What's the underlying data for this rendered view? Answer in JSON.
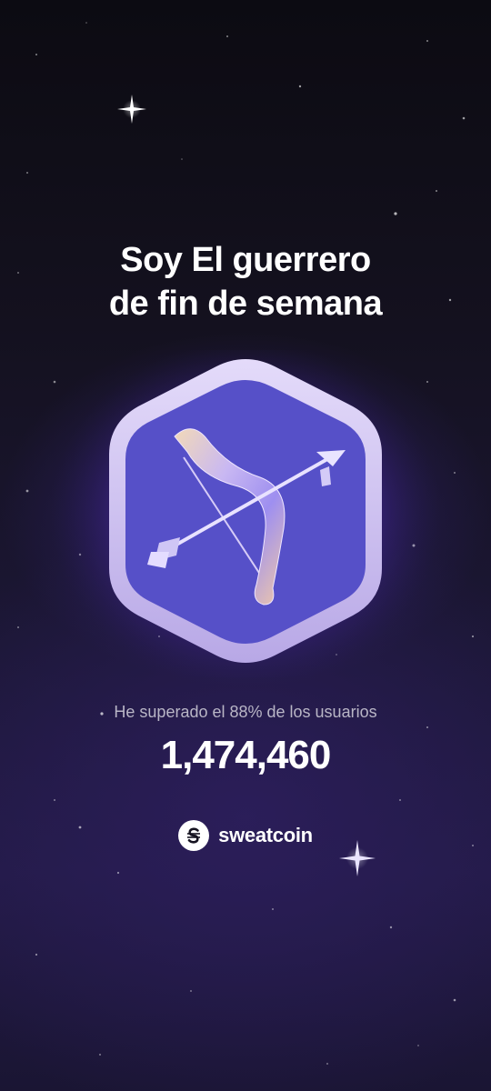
{
  "title": {
    "line1": "Soy El guerrero",
    "line2": "de fin de semana"
  },
  "badge": {
    "icon": "bow-and-arrow-icon",
    "colors": {
      "frame": "#cfc2ee",
      "face": "#5650c8",
      "glow": "#7b45ff"
    }
  },
  "stats": {
    "subtitle": "He superado el 88% de los usuarios",
    "count": "1,474,460"
  },
  "brand": {
    "icon": "sweatcoin-logo-icon",
    "name": "sweatcoin"
  }
}
